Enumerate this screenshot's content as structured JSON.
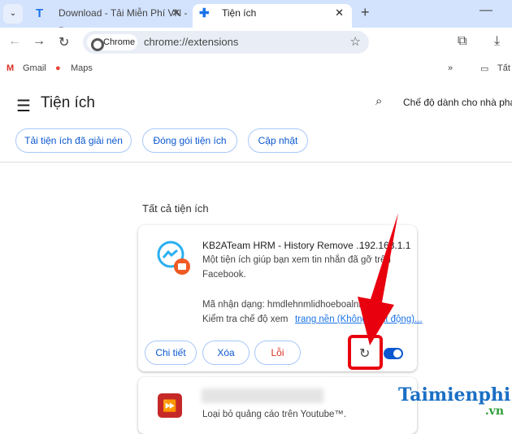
{
  "tabs": [
    {
      "label": "Download - Tải Miễn Phí VN - P",
      "icon": "T"
    },
    {
      "label": "Tiện ích",
      "icon": "puzzle-icon"
    }
  ],
  "omnibox": {
    "chip": "Chrome",
    "url": "chrome://extensions"
  },
  "bookmarks": [
    {
      "label": "Gmail"
    },
    {
      "label": "Maps"
    },
    {
      "label": "Tất"
    }
  ],
  "header": {
    "title": "Tiện ích",
    "dev_mode": "Chế độ dành cho nhà phát"
  },
  "actions": [
    "Tải tiện ích đã giải nén",
    "Đóng gói tiện ích",
    "Cập nhật"
  ],
  "section_title": "Tất cả tiện ích",
  "extensions": [
    {
      "name": "KB2ATeam HRM - History Remove ...",
      "version": "192.168.1.1",
      "desc1": "Một tiện ích giúp bạn xem tin nhắn đã gỡ trên",
      "desc2": "Facebook.",
      "id": "Mã nhận dạng: hmdlehnmlidhoeboalnk...",
      "inspect": "Kiểm tra chế độ xem",
      "inspect_link": "trang nền (Không hoạt động)...",
      "buttons": [
        "Chi tiết",
        "Xóa",
        "Lỗi"
      ],
      "enabled": true
    },
    {
      "desc1": "Loại bỏ quảng cáo trên Youtube™."
    }
  ],
  "watermark": "Taimienphi",
  "watermark_tld": ".vn"
}
